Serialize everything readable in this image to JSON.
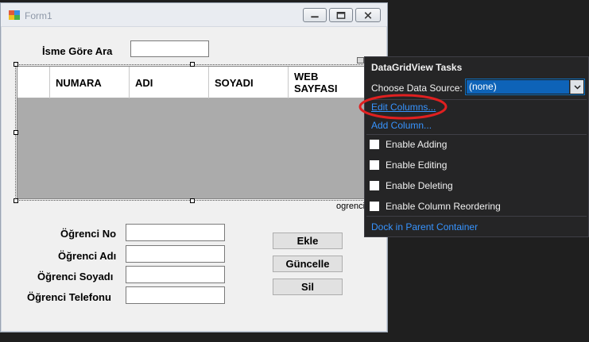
{
  "window": {
    "title": "Form1"
  },
  "search": {
    "label": "İsme Göre Ara",
    "value": ""
  },
  "grid": {
    "columns": [
      "NUMARA",
      "ADI",
      "SOYADI",
      "WEB\nSAYFASI"
    ],
    "datamember_label": "ogrenci"
  },
  "fields": [
    {
      "label": "Öğrenci No",
      "value": ""
    },
    {
      "label": "Öğrenci Adı",
      "value": ""
    },
    {
      "label": "Öğrenci Soyadı",
      "value": ""
    },
    {
      "label": "Öğrenci Telefonu",
      "value": ""
    }
  ],
  "buttons": {
    "add": "Ekle",
    "update": "Güncelle",
    "delete": "Sil"
  },
  "tasks": {
    "title": "DataGridView Tasks",
    "data_source_label": "Choose Data Source:",
    "data_source_value": "(none)",
    "edit_columns": "Edit Columns...",
    "add_column": "Add Column...",
    "enable_adding": "Enable Adding",
    "enable_editing": "Enable Editing",
    "enable_deleting": "Enable Deleting",
    "enable_reordering": "Enable Column Reordering",
    "dock": "Dock in Parent Container"
  },
  "colors": {
    "link": "#3794ff",
    "highlight": "#e02020",
    "panel_bg": "#252526"
  },
  "icons": [
    "form-icon",
    "minimize-icon",
    "maximize-icon",
    "close-icon",
    "chevron-down-icon",
    "smart-tag-icon"
  ]
}
